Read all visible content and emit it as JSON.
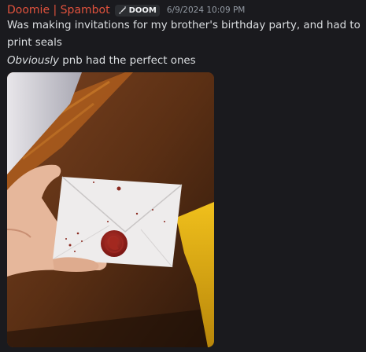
{
  "message": {
    "author": "Doomie | Spambot",
    "tag_label": "DOOM",
    "timestamp": "6/9/2024 10:09 PM",
    "lines": [
      "Was making invitations for my brother's birthday party, and had to",
      "print seals"
    ],
    "emphasis": "Obviously",
    "line3_rest": " pnb had the perfect ones"
  },
  "attachment": {
    "icon": "photo",
    "description_visible": false
  },
  "colors": {
    "background": "#1a1a1e",
    "username": "#e0523d",
    "text": "#dbdee1",
    "timestamp": "#949ba4",
    "seal": "#8b1f1a"
  },
  "icons": {
    "tag_icon": "brush-icon"
  }
}
